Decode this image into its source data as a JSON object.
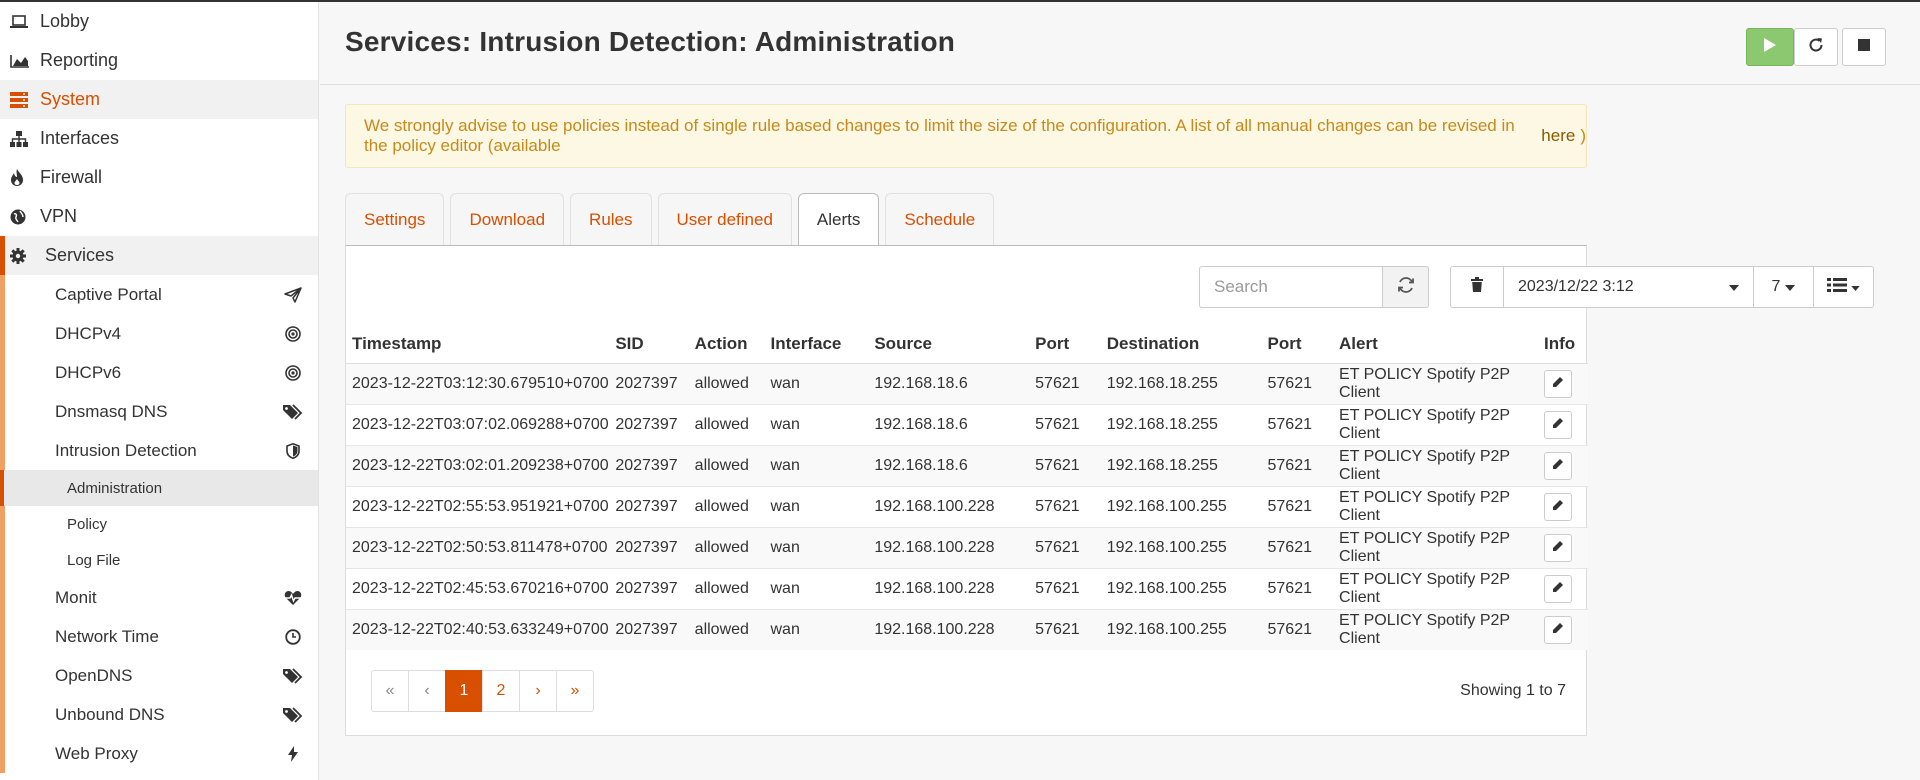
{
  "sidebar": {
    "top_items": [
      {
        "label": "Lobby",
        "icon": "laptop-icon"
      },
      {
        "label": "Reporting",
        "icon": "area-chart-icon"
      },
      {
        "label": "System",
        "icon": "server-icon"
      },
      {
        "label": "Interfaces",
        "icon": "sitemap-icon"
      },
      {
        "label": "Firewall",
        "icon": "fire-icon"
      },
      {
        "label": "VPN",
        "icon": "globe-icon"
      },
      {
        "label": "Services",
        "icon": "gear-icon"
      }
    ],
    "services": [
      {
        "label": "Captive Portal",
        "icon": "paper-plane-icon"
      },
      {
        "label": "DHCPv4",
        "icon": "bullseye-icon"
      },
      {
        "label": "DHCPv6",
        "icon": "bullseye-icon"
      },
      {
        "label": "Dnsmasq DNS",
        "icon": "tags-icon"
      },
      {
        "label": "Intrusion Detection",
        "icon": "shield-icon"
      },
      {
        "label": "Monit",
        "icon": "heartbeat-icon"
      },
      {
        "label": "Network Time",
        "icon": "clock-icon"
      },
      {
        "label": "OpenDNS",
        "icon": "tags-icon"
      },
      {
        "label": "Unbound DNS",
        "icon": "tags-icon"
      },
      {
        "label": "Web Proxy",
        "icon": "bolt-icon"
      }
    ],
    "ids_sub": [
      "Administration",
      "Policy",
      "Log File"
    ]
  },
  "header": {
    "title": "Services: Intrusion Detection: Administration"
  },
  "notice": {
    "text": "We strongly advise to use policies instead of single rule based changes to limit the size of the configuration. A list of all manual changes can be revised in the policy editor (available",
    "link": "here",
    "suffix": ")"
  },
  "tabs": [
    "Settings",
    "Download",
    "Rules",
    "User defined",
    "Alerts",
    "Schedule"
  ],
  "toolbar": {
    "search_placeholder": "Search",
    "date_value": "2023/12/22 3:12",
    "count_value": "7"
  },
  "table": {
    "columns": [
      "Timestamp",
      "SID",
      "Action",
      "Interface",
      "Source",
      "Port",
      "Destination",
      "Port",
      "Alert",
      "Info"
    ],
    "rows": [
      [
        "2023-12-22T03:12:30.679510+0700",
        "2027397",
        "allowed",
        "wan",
        "192.168.18.6",
        "57621",
        "192.168.18.255",
        "57621",
        "ET POLICY Spotify P2P Client"
      ],
      [
        "2023-12-22T03:07:02.069288+0700",
        "2027397",
        "allowed",
        "wan",
        "192.168.18.6",
        "57621",
        "192.168.18.255",
        "57621",
        "ET POLICY Spotify P2P Client"
      ],
      [
        "2023-12-22T03:02:01.209238+0700",
        "2027397",
        "allowed",
        "wan",
        "192.168.18.6",
        "57621",
        "192.168.18.255",
        "57621",
        "ET POLICY Spotify P2P Client"
      ],
      [
        "2023-12-22T02:55:53.951921+0700",
        "2027397",
        "allowed",
        "wan",
        "192.168.100.228",
        "57621",
        "192.168.100.255",
        "57621",
        "ET POLICY Spotify P2P Client"
      ],
      [
        "2023-12-22T02:50:53.811478+0700",
        "2027397",
        "allowed",
        "wan",
        "192.168.100.228",
        "57621",
        "192.168.100.255",
        "57621",
        "ET POLICY Spotify P2P Client"
      ],
      [
        "2023-12-22T02:45:53.670216+0700",
        "2027397",
        "allowed",
        "wan",
        "192.168.100.228",
        "57621",
        "192.168.100.255",
        "57621",
        "ET POLICY Spotify P2P Client"
      ],
      [
        "2023-12-22T02:40:53.633249+0700",
        "2027397",
        "allowed",
        "wan",
        "192.168.100.228",
        "57621",
        "192.168.100.255",
        "57621",
        "ET POLICY Spotify P2P Client"
      ]
    ]
  },
  "pagination": {
    "first": "«",
    "prev": "‹",
    "pages": [
      "1",
      "2"
    ],
    "next": "›",
    "last": "»",
    "showing": "Showing 1 to 7"
  },
  "colors": {
    "accent": "#d94f00",
    "play_green": "#8cc870",
    "notice_text": "#c78a1a"
  }
}
